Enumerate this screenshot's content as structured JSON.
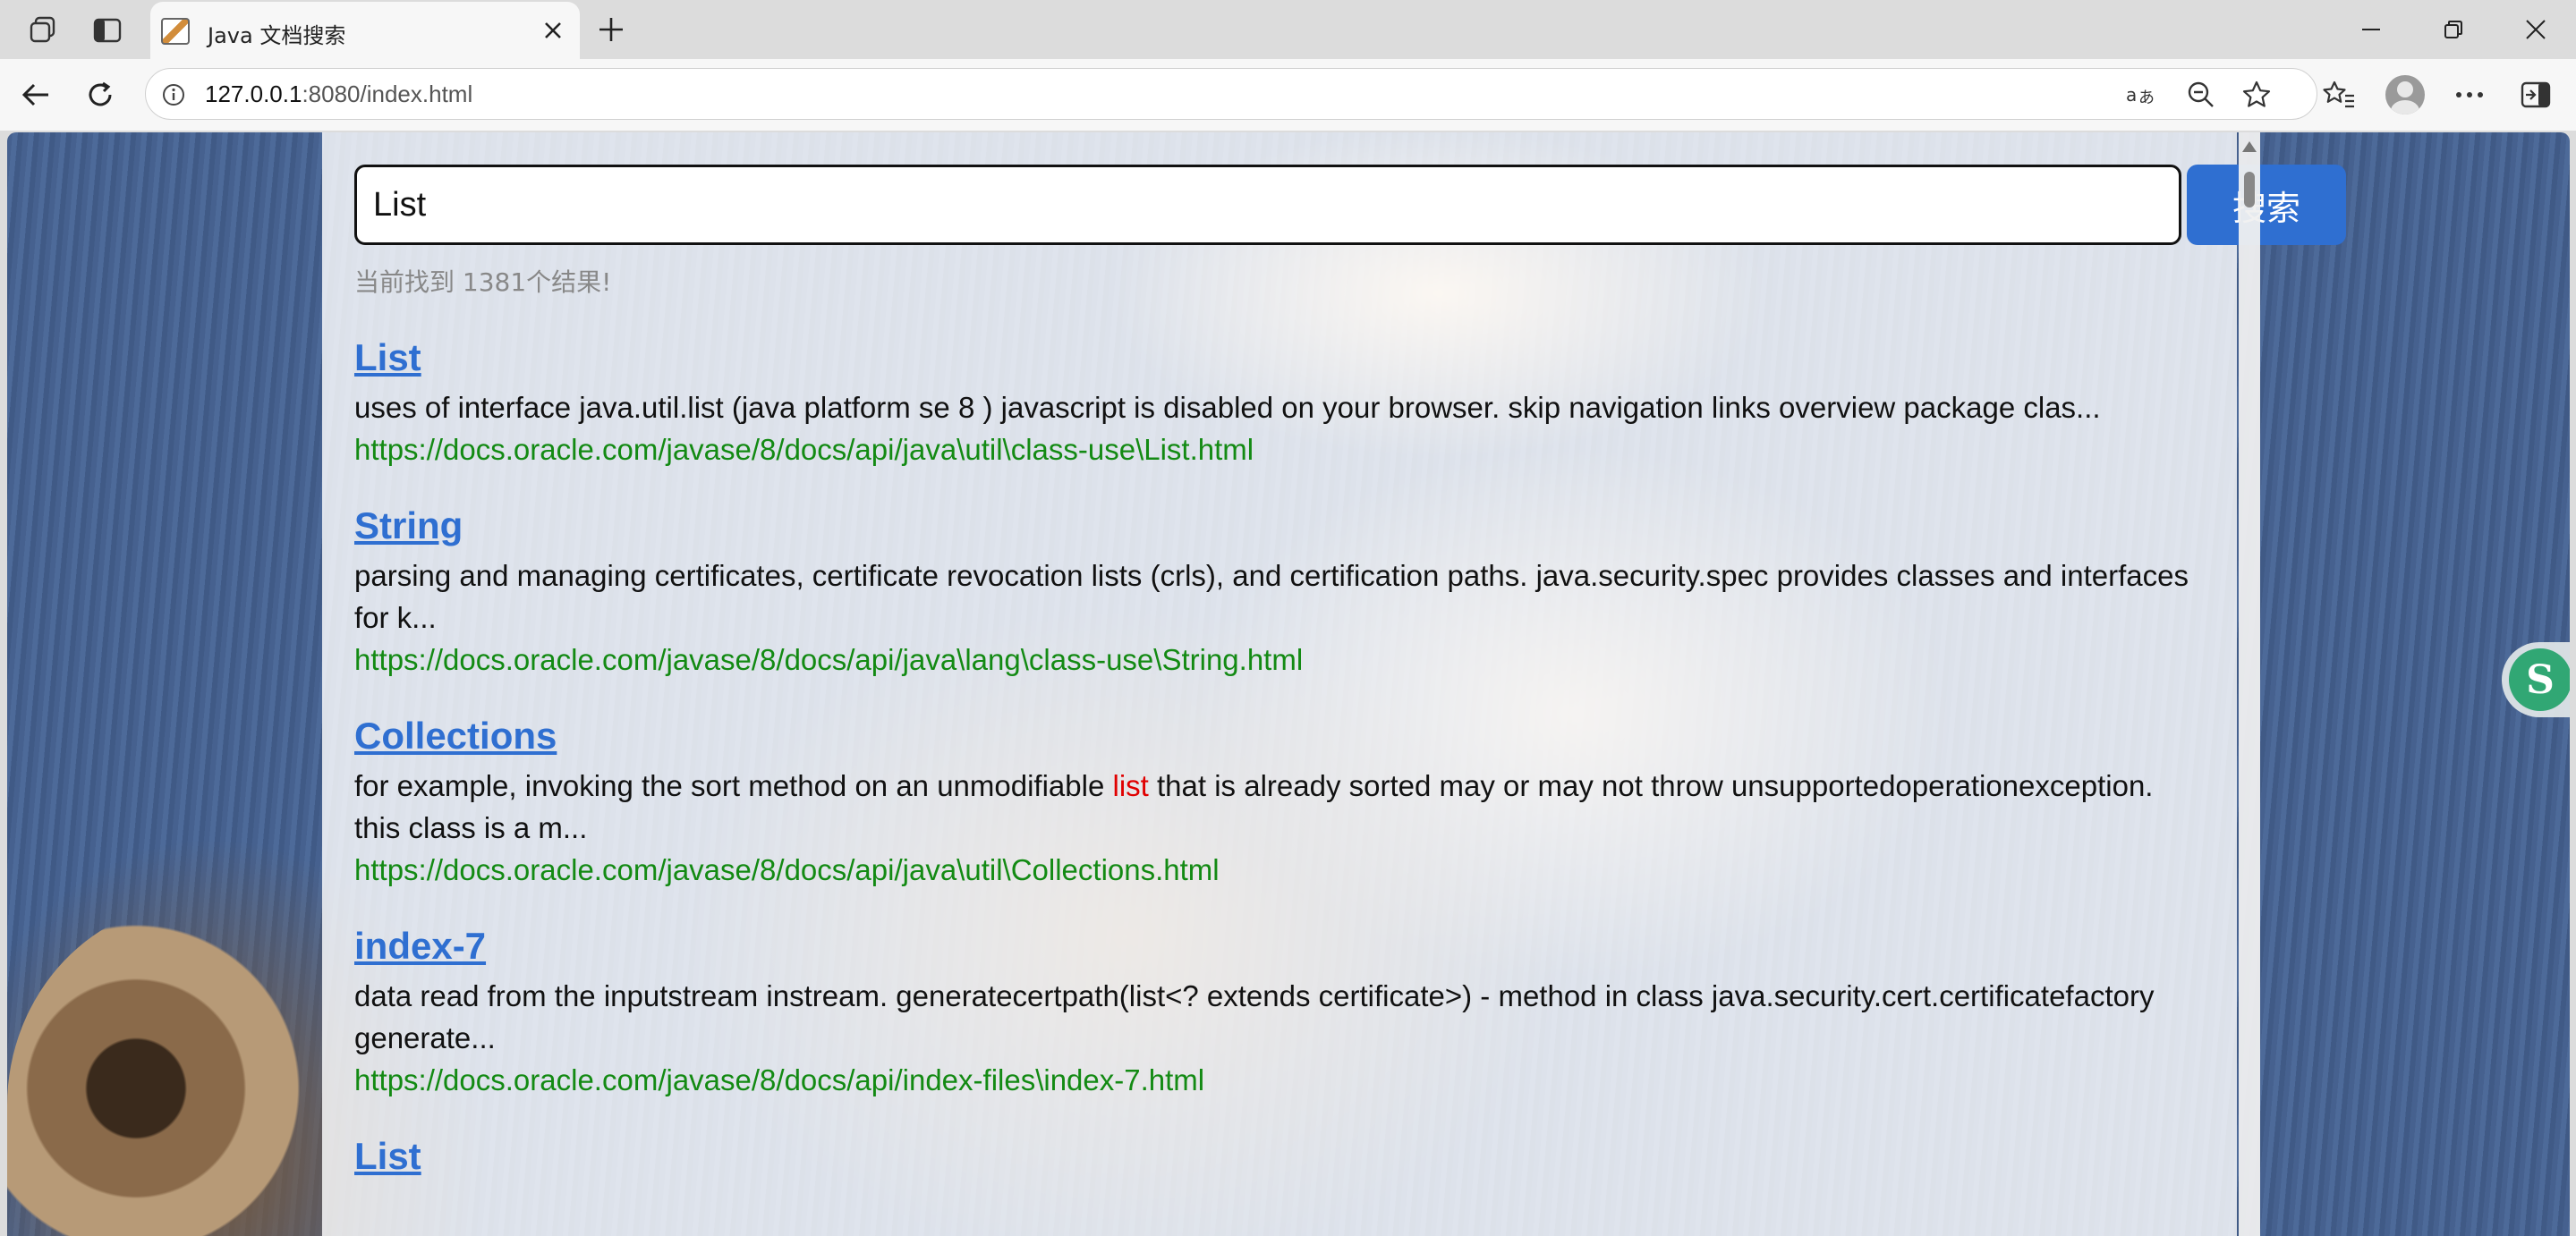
{
  "browser": {
    "tab_title": "Java 文档搜索",
    "url_host": "127.0.0.1",
    "url_rest": ":8080/index.html",
    "icons": [
      "workspaces-icon",
      "vertical-tabs-icon",
      "tab-favicon",
      "close-icon",
      "new-tab-icon",
      "minimize-icon",
      "restore-icon",
      "window-close-icon",
      "back-icon",
      "refresh-icon",
      "info-icon",
      "read-aloud-icon",
      "zoom-out-icon",
      "favorite-star-icon",
      "favorites-icon",
      "profile-avatar",
      "more-icon",
      "sidebar-icon"
    ]
  },
  "search": {
    "query": "List",
    "button_label": "搜索",
    "count_text": "当前找到 1381个结果!"
  },
  "results": [
    {
      "title": "List",
      "desc_before": "uses of interface java.util.list (java platform se 8 ) javascript is disabled on your browser. skip navigation links overview package clas...",
      "desc_hl": "",
      "desc_after": "",
      "url": "https://docs.oracle.com/javase/8/docs/api/java\\util\\class-use\\List.html"
    },
    {
      "title": "String",
      "desc_before": "parsing and managing certificates, certificate revocation lists (crls), and certification paths. java.security.spec provides classes and interfaces for k...",
      "desc_hl": "",
      "desc_after": "",
      "url": "https://docs.oracle.com/javase/8/docs/api/java\\lang\\class-use\\String.html"
    },
    {
      "title": "Collections",
      "desc_before": "for example, invoking the sort method on an unmodifiable ",
      "desc_hl": "list",
      "desc_after": " that is already sorted may or may not throw unsupportedoperationexception. this class is a m...",
      "url": "https://docs.oracle.com/javase/8/docs/api/java\\util\\Collections.html"
    },
    {
      "title": "index-7",
      "desc_before": "data read from the inputstream instream. generatecertpath(list<? extends certificate>) - method in class java.security.cert.certificatefactory generate...",
      "desc_hl": "",
      "desc_after": "",
      "url": "https://docs.oracle.com/javase/8/docs/api/index-files\\index-7.html"
    },
    {
      "title": "List",
      "desc_before": "",
      "desc_hl": "",
      "desc_after": "",
      "url": ""
    }
  ],
  "colors": {
    "link_blue": "#2f6fd1",
    "url_green": "#138a13",
    "highlight_red": "#e00000",
    "button_blue": "#2f6fd1"
  }
}
